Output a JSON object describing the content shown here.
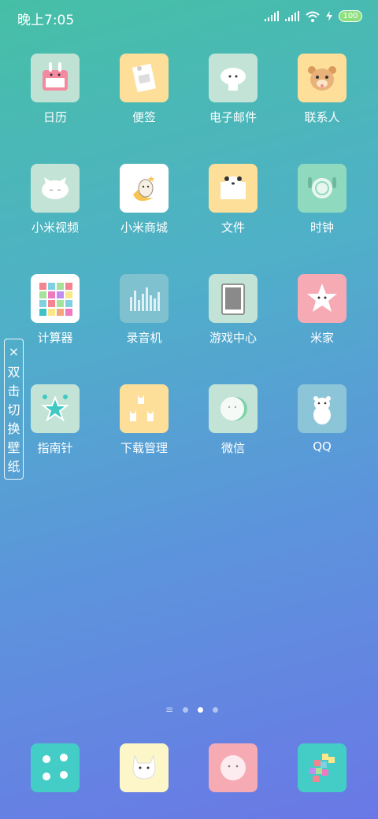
{
  "status": {
    "time": "晚上7:05",
    "battery": "100",
    "icons": [
      "signal-icon",
      "signal-icon",
      "wifi-icon",
      "charging-icon",
      "battery-icon"
    ]
  },
  "apps": [
    {
      "label": "日历",
      "icon": "calendar-icon",
      "bg": "#bfe2d4"
    },
    {
      "label": "便签",
      "icon": "notes-icon",
      "bg": "#fddf9a"
    },
    {
      "label": "电子邮件",
      "icon": "email-icon",
      "bg": "#c3e3d7"
    },
    {
      "label": "联系人",
      "icon": "contacts-icon",
      "bg": "#fddf9a"
    },
    {
      "label": "小米视频",
      "icon": "video-icon",
      "bg": "#c3e3d7"
    },
    {
      "label": "小米商城",
      "icon": "mall-icon",
      "bg": "#ffffff"
    },
    {
      "label": "文件",
      "icon": "files-icon",
      "bg": "#fddf9a"
    },
    {
      "label": "时钟",
      "icon": "clock-icon",
      "bg": "#8fd9be"
    },
    {
      "label": "计算器",
      "icon": "calculator-icon",
      "bg": "#ffffff"
    },
    {
      "label": "录音机",
      "icon": "recorder-icon",
      "bg": "#7fc1cf"
    },
    {
      "label": "游戏中心",
      "icon": "game-center-icon",
      "bg": "#c3e3d7"
    },
    {
      "label": "米家",
      "icon": "mijia-icon",
      "bg": "#f6aab4"
    },
    {
      "label": "指南针",
      "icon": "compass-icon",
      "bg": "#c3e3d7"
    },
    {
      "label": "下载管理",
      "icon": "downloads-icon",
      "bg": "#fddf9a"
    },
    {
      "label": "微信",
      "icon": "wechat-icon",
      "bg": "#c3e3d7"
    },
    {
      "label": "QQ",
      "icon": "qq-icon",
      "bg": "#8cc5d8"
    }
  ],
  "wallpaper_tip": {
    "text": "双击切换壁纸",
    "close": "×"
  },
  "page_indicator": {
    "count": 3,
    "active": 1
  },
  "dock": [
    {
      "icon": "flower-icon",
      "bg": "#44cdc6"
    },
    {
      "icon": "cat-icon",
      "bg": "#fdf6c8"
    },
    {
      "icon": "face-icon",
      "bg": "#f6aab4"
    },
    {
      "icon": "pixel-icon",
      "bg": "#44cdc6"
    }
  ]
}
